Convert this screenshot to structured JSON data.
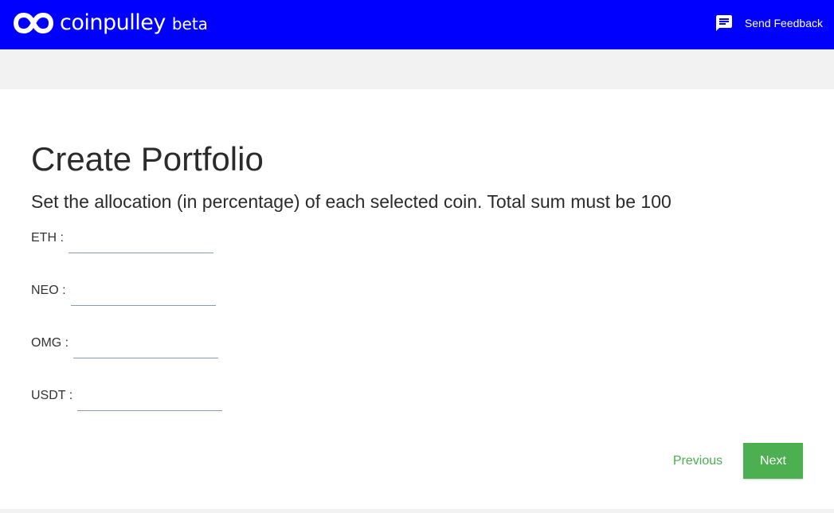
{
  "header": {
    "brand": "coinpulley",
    "badge": "beta",
    "feedback_label": "Send Feedback",
    "background_color": "#0000ff",
    "logo_icon": "infinity-icon",
    "feedback_icon": "feedback-message-icon"
  },
  "main": {
    "title": "Create Portfolio",
    "subtitle": "Set the allocation (in percentage) of each selected coin. Total sum must be 100",
    "coins": [
      {
        "label": "ETH :",
        "value": ""
      },
      {
        "label": "NEO :",
        "value": ""
      },
      {
        "label": "OMG :",
        "value": ""
      },
      {
        "label": "USDT :",
        "value": ""
      }
    ]
  },
  "actions": {
    "previous_label": "Previous",
    "next_label": "Next",
    "accent_color": "#4caf50"
  }
}
